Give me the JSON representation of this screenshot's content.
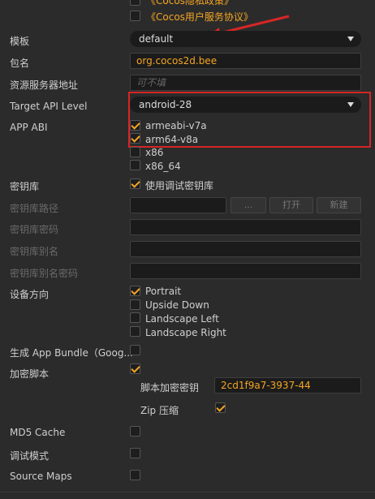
{
  "top": {
    "privacy_policy": "《Cocos隐私政策》",
    "user_agreement": "《Cocos用户服务协议》"
  },
  "template": {
    "label": "模板",
    "value": "default"
  },
  "package_name": {
    "label": "包名",
    "value": "org.cocos2d.bee"
  },
  "resource_server": {
    "label": "资源服务器地址",
    "placeholder": "可不填"
  },
  "target_api": {
    "label": "Target API Level",
    "value": "android-28"
  },
  "app_abi": {
    "label": "APP ABI",
    "options": [
      {
        "label": "armeabi-v7a",
        "checked": true
      },
      {
        "label": "arm64-v8a",
        "checked": true
      },
      {
        "label": "x86",
        "checked": false
      },
      {
        "label": "x86_64",
        "checked": false
      }
    ]
  },
  "keystore": {
    "label": "密钥库",
    "debug_label": "使用调试密钥库",
    "path_label": "密钥库路径",
    "dots_button": "...",
    "open_button": "打开",
    "new_button": "新建",
    "password_label": "密钥库密码",
    "alias_label": "密钥库别名",
    "alias_password_label": "密钥库别名密码"
  },
  "orientation": {
    "label": "设备方向",
    "options": [
      {
        "label": "Portrait",
        "checked": true
      },
      {
        "label": "Upside Down",
        "checked": false
      },
      {
        "label": "Landscape Left",
        "checked": false
      },
      {
        "label": "Landscape Right",
        "checked": false
      }
    ]
  },
  "app_bundle": {
    "label": "生成 App Bundle（Goog..."
  },
  "encrypt": {
    "label": "加密脚本",
    "key_label": "脚本加密密钥",
    "key_value": "2cd1f9a7-3937-44",
    "zip_label": "Zip 压缩"
  },
  "md5": {
    "label": "MD5 Cache"
  },
  "debug": {
    "label": "调试模式"
  },
  "sourcemaps": {
    "label": "Source Maps"
  },
  "colors": {
    "accent": "#f5a623",
    "highlight": "#d52626"
  }
}
